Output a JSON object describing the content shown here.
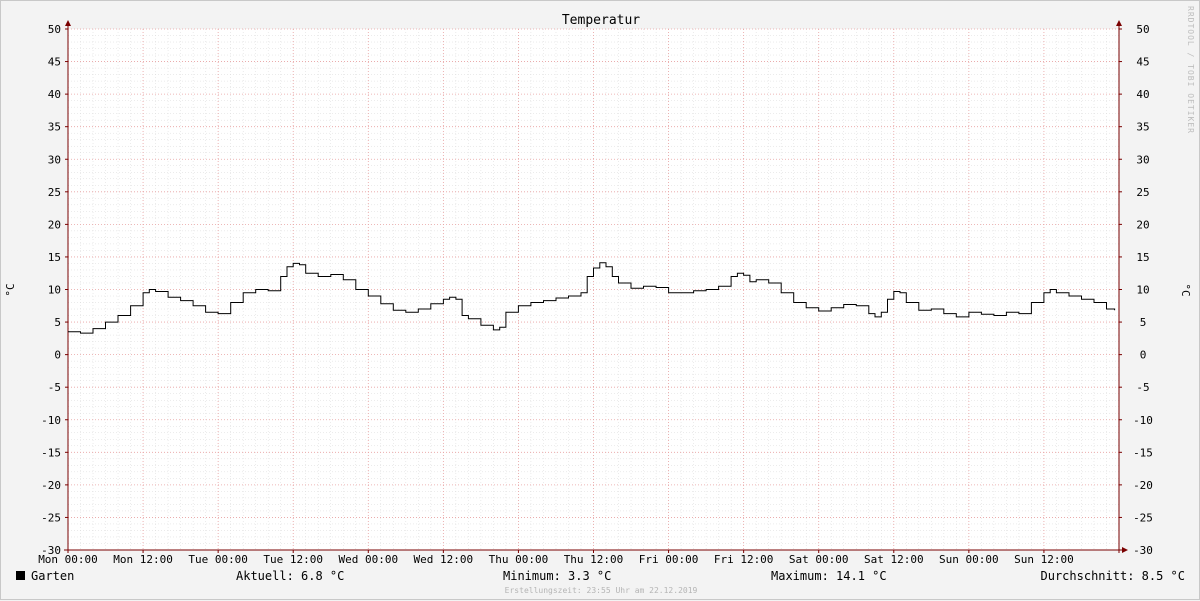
{
  "chart_data": {
    "type": "line",
    "title": "Temperatur",
    "ylabel": "°C",
    "xlabel": "",
    "ylim": [
      -30,
      50
    ],
    "xlim": [
      0,
      168
    ],
    "y_ticks": [
      50,
      45,
      40,
      35,
      30,
      25,
      20,
      15,
      10,
      5,
      0,
      -5,
      -10,
      -15,
      -20,
      -25,
      -30
    ],
    "x_ticks": [
      {
        "x": 0,
        "label": "Mon 00:00"
      },
      {
        "x": 12,
        "label": "Mon 12:00"
      },
      {
        "x": 24,
        "label": "Tue 00:00"
      },
      {
        "x": 36,
        "label": "Tue 12:00"
      },
      {
        "x": 48,
        "label": "Wed 00:00"
      },
      {
        "x": 60,
        "label": "Wed 12:00"
      },
      {
        "x": 72,
        "label": "Thu 00:00"
      },
      {
        "x": 84,
        "label": "Thu 12:00"
      },
      {
        "x": 96,
        "label": "Fri 00:00"
      },
      {
        "x": 108,
        "label": "Fri 12:00"
      },
      {
        "x": 120,
        "label": "Sat 00:00"
      },
      {
        "x": 132,
        "label": "Sat 12:00"
      },
      {
        "x": 144,
        "label": "Sun 00:00"
      },
      {
        "x": 156,
        "label": "Sun 12:00"
      }
    ],
    "grid": true,
    "series": [
      {
        "name": "Garten",
        "color": "#000000",
        "x": [
          0,
          2,
          4,
          6,
          8,
          10,
          12,
          13,
          14,
          16,
          18,
          20,
          22,
          24,
          26,
          28,
          30,
          32,
          34,
          35,
          36,
          37,
          38,
          40,
          42,
          44,
          46,
          48,
          50,
          52,
          54,
          56,
          58,
          60,
          61,
          62,
          63,
          64,
          66,
          68,
          69,
          70,
          72,
          74,
          76,
          78,
          80,
          82,
          83,
          84,
          85,
          86,
          87,
          88,
          90,
          92,
          94,
          96,
          98,
          100,
          102,
          104,
          106,
          107,
          108,
          109,
          110,
          112,
          114,
          116,
          118,
          120,
          122,
          124,
          126,
          128,
          129,
          130,
          131,
          132,
          133,
          134,
          136,
          138,
          140,
          142,
          144,
          146,
          148,
          150,
          152,
          154,
          156,
          157,
          158,
          160,
          162,
          164,
          166,
          167.3
        ],
        "values": [
          3.5,
          3.3,
          4.0,
          5.0,
          6.0,
          7.5,
          9.5,
          10.0,
          9.7,
          8.8,
          8.3,
          7.5,
          6.5,
          6.3,
          8.0,
          9.5,
          10.0,
          9.8,
          12.0,
          13.5,
          14.0,
          13.8,
          12.5,
          12.0,
          12.3,
          11.5,
          10.0,
          9.0,
          7.8,
          6.8,
          6.5,
          7.0,
          7.8,
          8.5,
          8.8,
          8.5,
          6.0,
          5.5,
          4.5,
          3.8,
          4.2,
          6.5,
          7.5,
          8.0,
          8.3,
          8.7,
          9.0,
          9.5,
          12.0,
          13.3,
          14.1,
          13.5,
          12.0,
          11.0,
          10.2,
          10.5,
          10.3,
          9.5,
          9.5,
          9.8,
          10.0,
          10.5,
          12.0,
          12.5,
          12.2,
          11.2,
          11.5,
          11.0,
          9.5,
          8.0,
          7.2,
          6.7,
          7.2,
          7.7,
          7.5,
          6.3,
          5.8,
          6.5,
          8.5,
          9.7,
          9.5,
          8.0,
          6.8,
          7.0,
          6.3,
          5.8,
          6.5,
          6.2,
          6.0,
          6.5,
          6.3,
          8.0,
          9.5,
          10.0,
          9.5,
          9.0,
          8.5,
          8.0,
          7.0,
          6.8
        ]
      }
    ]
  },
  "legend": {
    "series_name": "Garten",
    "aktuell": "Aktuell: 6.8 °C",
    "minimum": "Minimum: 3.3 °C",
    "maximum": "Maximum: 14.1 °C",
    "durchschnitt": "Durchschnitt: 8.5 °C"
  },
  "footer": "Erstellungszeit: 23:55 Uhr am 22.12.2019",
  "watermark": "RRDTOOL / TOBI OETIKER",
  "colors": {
    "background": "#f3f3f3",
    "canvas": "#ffffff",
    "major_grid": "#e8a0a0",
    "minor_grid": "#d8d8d8",
    "axis": "#7a0000",
    "line": "#000000"
  }
}
